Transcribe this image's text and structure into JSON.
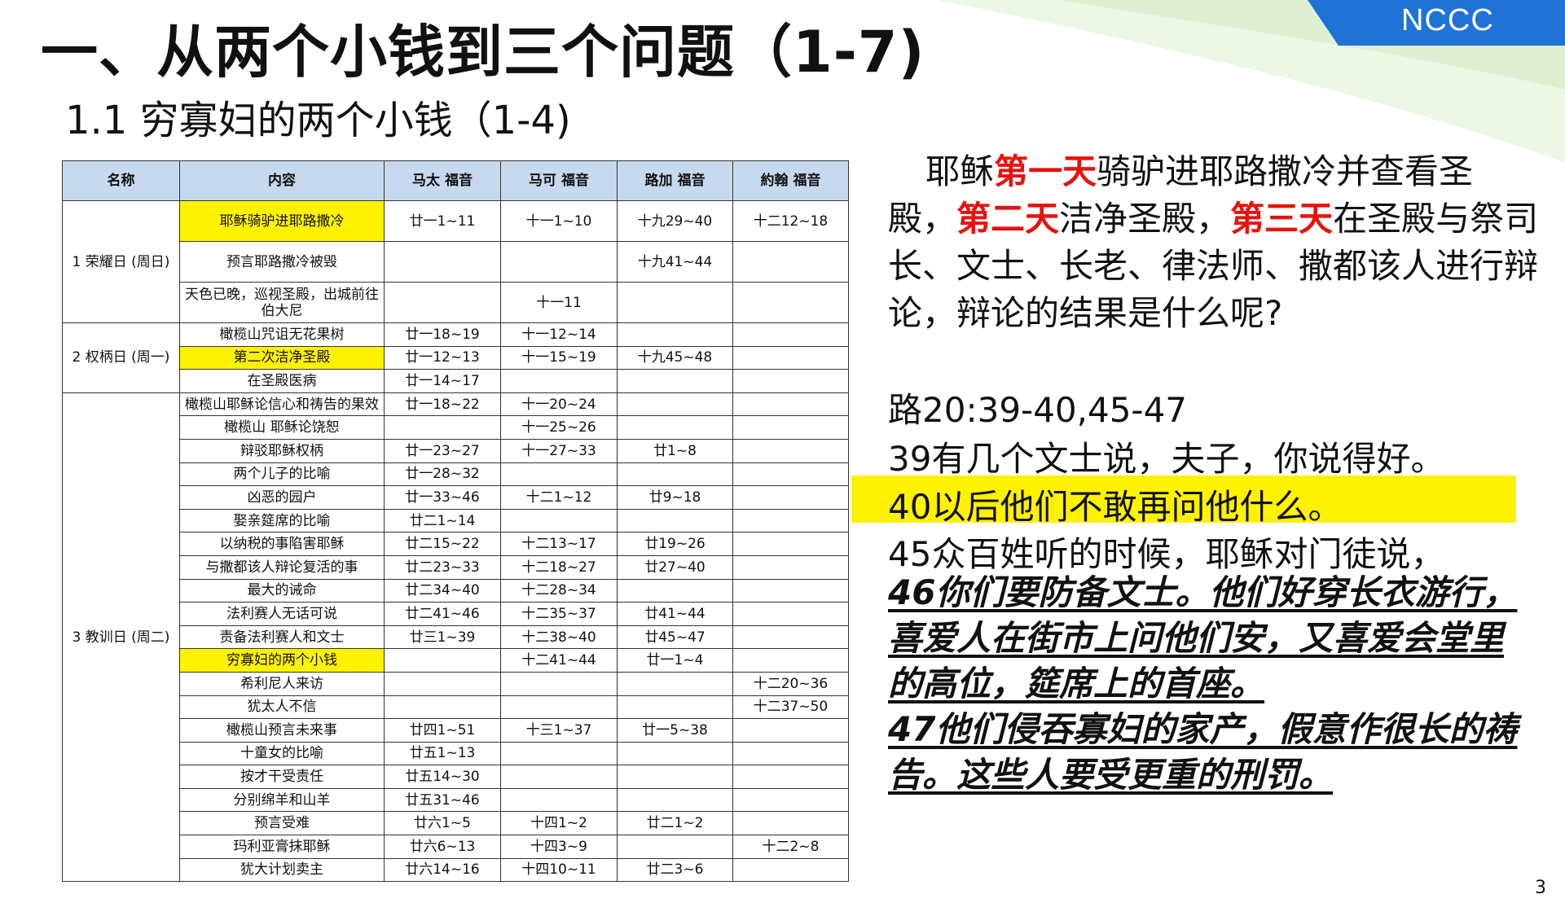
{
  "header": {
    "title": "一、从两个小钱到三个问题（1-7)",
    "subtitle": "1.1 穷寡妇的两个小钱（1-4)",
    "badge": "NCCC",
    "page_number": "3"
  },
  "table": {
    "headers": [
      "名称",
      "内容",
      "马太\n福音",
      "马可\n福音",
      "路加\n福音",
      "約翰\n福音"
    ],
    "days": [
      {
        "label": "1 荣耀日\n(周日)"
      },
      {
        "label": "2 权柄日\n(周一)"
      },
      {
        "label": "3 教训日\n(周二)"
      }
    ],
    "rows": [
      {
        "content": "耶稣骑驴进耶路撒冷",
        "matthew": "廿一1~11",
        "mark": "十一1~10",
        "luke": "十九29~40",
        "john": "十二12~18"
      },
      {
        "content": "预言耶路撒冷被毁",
        "matthew": "",
        "mark": "",
        "luke": "十九41~44",
        "john": ""
      },
      {
        "content": "天色已晚，巡视圣殿，出城前往伯大尼",
        "matthew": "",
        "mark": "十一11",
        "luke": "",
        "john": ""
      },
      {
        "content": "橄榄山咒诅无花果树",
        "matthew": "廿一18~19",
        "mark": "十一12~14",
        "luke": "",
        "john": ""
      },
      {
        "content": "第二次洁净圣殿",
        "matthew": "廿一12~13",
        "mark": "十一15~19",
        "luke": "十九45~48",
        "john": ""
      },
      {
        "content": "在圣殿医病",
        "matthew": "廿一14~17",
        "mark": "",
        "luke": "",
        "john": ""
      },
      {
        "content": "橄榄山耶稣论信心和祷告的果效",
        "matthew": "廿一18~22",
        "mark": "十一20~24",
        "luke": "",
        "john": ""
      },
      {
        "content": "橄榄山 耶稣论饶恕",
        "matthew": "",
        "mark": "十一25~26",
        "luke": "",
        "john": ""
      },
      {
        "content": "辩驳耶稣权柄",
        "matthew": "廿一23~27",
        "mark": "十一27~33",
        "luke": "廿1~8",
        "john": ""
      },
      {
        "content": "两个儿子的比喻",
        "matthew": "廿一28~32",
        "mark": "",
        "luke": "",
        "john": ""
      },
      {
        "content": "凶恶的园户",
        "matthew": "廿一33~46",
        "mark": "十二1~12",
        "luke": "廿9~18",
        "john": ""
      },
      {
        "content": "娶亲筵席的比喻",
        "matthew": "廿二1~14",
        "mark": "",
        "luke": "",
        "john": ""
      },
      {
        "content": "以纳税的事陷害耶稣",
        "matthew": "廿二15~22",
        "mark": "十二13~17",
        "luke": "廿19~26",
        "john": ""
      },
      {
        "content": "与撒都该人辩论复活的事",
        "matthew": "廿二23~33",
        "mark": "十二18~27",
        "luke": "廿27~40",
        "john": ""
      },
      {
        "content": "最大的诫命",
        "matthew": "廿二34~40",
        "mark": "十二28~34",
        "luke": "",
        "john": ""
      },
      {
        "content": "法利赛人无话可说",
        "matthew": "廿二41~46",
        "mark": "十二35~37",
        "luke": "廿41~44",
        "john": ""
      },
      {
        "content": "责备法利赛人和文士",
        "matthew": "廿三1~39",
        "mark": "十二38~40",
        "luke": "廿45~47",
        "john": ""
      },
      {
        "content": "穷寡妇的两个小钱",
        "matthew": "",
        "mark": "十二41~44",
        "luke": "廿一1~4",
        "john": ""
      },
      {
        "content": "希利尼人来访",
        "matthew": "",
        "mark": "",
        "luke": "",
        "john": "十二20~36"
      },
      {
        "content": "犹太人不信",
        "matthew": "",
        "mark": "",
        "luke": "",
        "john": "十二37~50"
      },
      {
        "content": "橄榄山预言未来事",
        "matthew": "廿四1~51",
        "mark": "十三1~37",
        "luke": "廿一5~38",
        "john": ""
      },
      {
        "content": "十童女的比喻",
        "matthew": "廿五1~13",
        "mark": "",
        "luke": "",
        "john": ""
      },
      {
        "content": "按才干受责任",
        "matthew": "廿五14~30",
        "mark": "",
        "luke": "",
        "john": ""
      },
      {
        "content": "分别绵羊和山羊",
        "matthew": "廿五31~46",
        "mark": "",
        "luke": "",
        "john": ""
      },
      {
        "content": "预言受难",
        "matthew": "廿六1~5",
        "mark": "十四1~2",
        "luke": "廿二1~2",
        "john": ""
      },
      {
        "content": "玛利亚膏抹耶稣",
        "matthew": "廿六6~13",
        "mark": "十四3~9",
        "luke": "",
        "john": "十二2~8"
      },
      {
        "content": "犹大计划卖主",
        "matthew": "廿六14~16",
        "mark": "十四10~11",
        "luke": "廿二3~6",
        "john": ""
      }
    ]
  },
  "right": {
    "intro": {
      "p1": "耶稣",
      "r1": "第一天",
      "p2": "骑驴进耶路撒冷并查看圣殿，",
      "r2": "第二天",
      "p3": "洁净圣殿，",
      "r3": "第三天",
      "p4": "在圣殿与祭司长、文士、长老、律法师、撒都该人进行辩论，辩论的结果是什么呢?"
    },
    "ref": "路20:39-40,45-47",
    "v39": "39有几个文士说，夫子，你说得好。",
    "v40": "40以后他们不敢再问他什么。",
    "v45": "45众百姓听的时候，耶稣对门徒说，",
    "v46": "46你们要防备文士。他们好穿长衣游行，喜爱人在街市上问他们安，又喜爱会堂里的高位，筵席上的首座。",
    "v47": "47他们侵吞寡妇的家产，假意作很长的祷告。这些人要受更重的刑罚。"
  },
  "colors": {
    "highlight": "#fff200",
    "emphasis_red": "#e8120c",
    "header_fill": "#c6d9ee",
    "badge_blue": "#1f73d6"
  }
}
